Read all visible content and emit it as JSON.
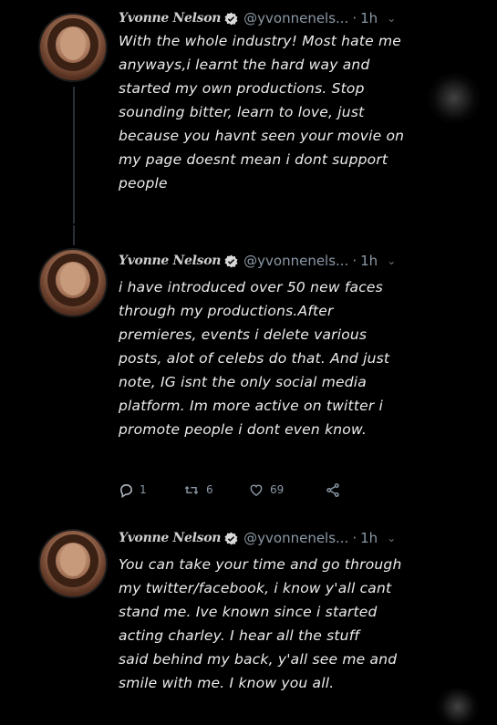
{
  "tweets": [
    {
      "author_name": "Yvonne Nelson",
      "handle": "@yvonnenels...",
      "separator": "·",
      "time": "1h",
      "text": "With the whole industry! Most hate me\nanyways,i learnt the hard way and\nstarted my own productions. Stop\nsounding bitter, learn to love, just\nbecause you havnt seen your movie on\nmy page doesnt mean i dont support\npeople"
    },
    {
      "author_name": "Yvonne Nelson",
      "handle": "@yvonnenels...",
      "separator": "·",
      "time": "1h",
      "text": "i have introduced over 50 new faces\nthrough my productions.After\npremieres, events i delete various\nposts, alot of celebs do that. And just\nnote, IG isnt the only social media\nplatform. Im more active on twitter i\npromote people i dont even know.",
      "actions": {
        "reply_count": "1",
        "retweet_count": "6",
        "like_count": "69"
      }
    },
    {
      "author_name": "Yvonne Nelson",
      "handle": "@yvonnenels...",
      "separator": "·",
      "time": "1h",
      "text": "You can take your time and go through\nmy twitter/facebook, i know y'all cant\nstand me. Ive known since i started\nacting charley. I hear all the stuff\nsaid behind my back, y'all see me and\nsmile with me. I know you all."
    }
  ],
  "colors": {
    "background": "#000000",
    "text": "#ececec",
    "muted": "#8b98a5",
    "verified": "#d9d9d9"
  },
  "icons": [
    "verified-icon",
    "chevron-down-icon",
    "reply-icon",
    "retweet-icon",
    "like-icon",
    "share-icon"
  ]
}
